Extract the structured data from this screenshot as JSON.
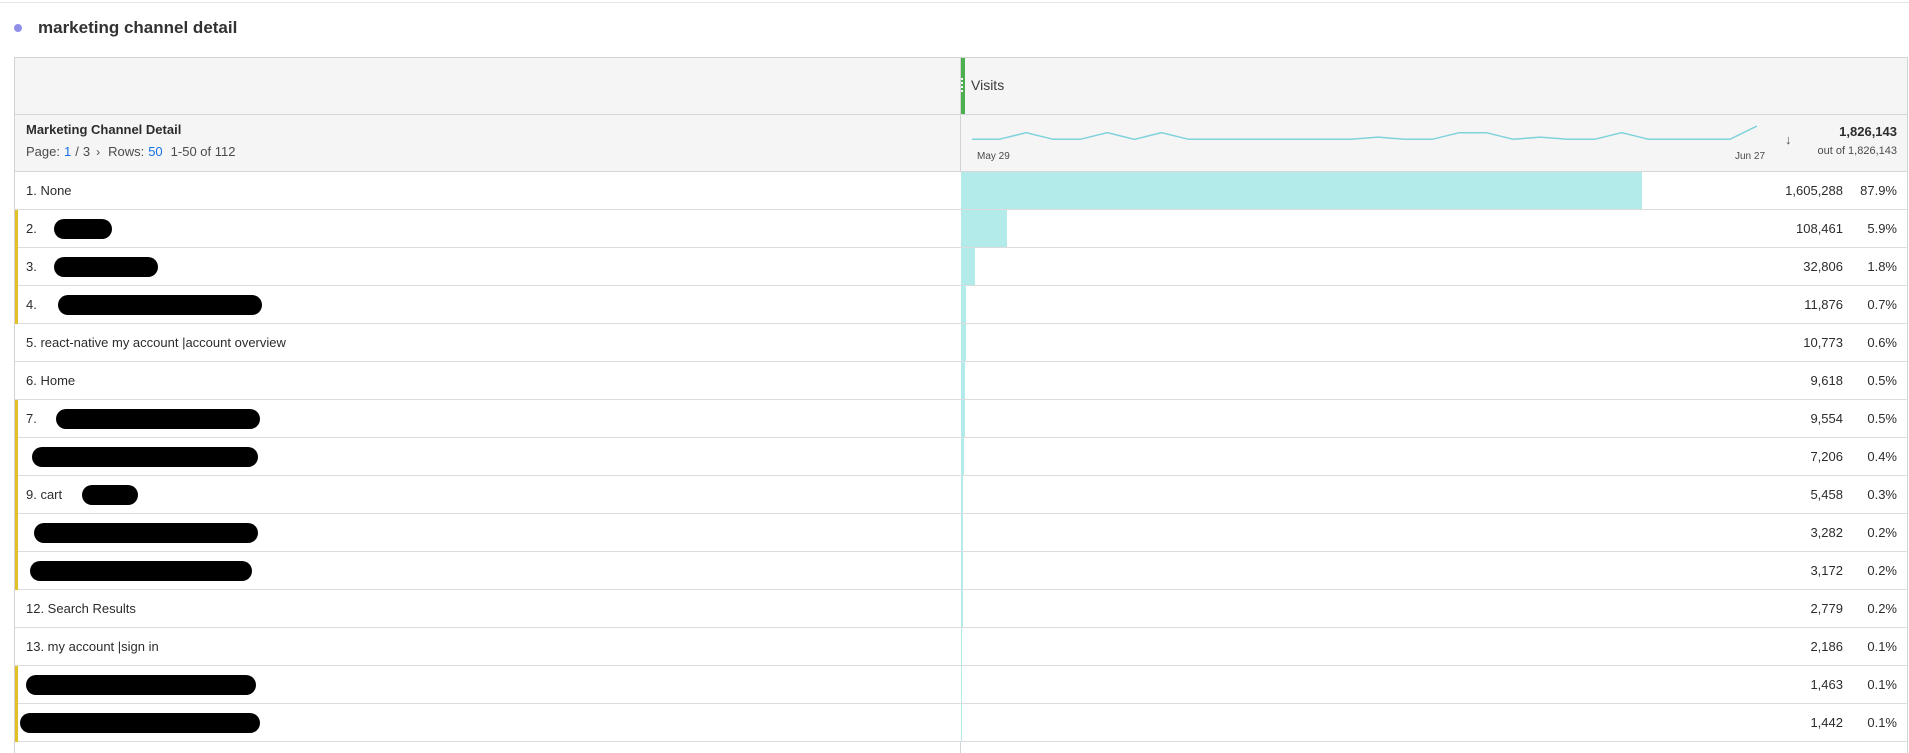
{
  "panel": {
    "title": "marketing channel detail",
    "dot_color": "#8f8fe8"
  },
  "table": {
    "metric_label": "Visits",
    "dimension_title": "Marketing Channel Detail",
    "pager": {
      "page_label": "Page:",
      "current_page": "1",
      "page_sep": "/",
      "total_pages": "3",
      "chevron": "›",
      "rows_label": "Rows:",
      "rows_value": "50",
      "range": "1-50 of 112"
    },
    "sparkline": {
      "start_label": "May 29",
      "end_label": "Jun 27",
      "color": "#7fd2dc",
      "points": [
        3,
        3,
        6,
        3,
        3,
        6,
        3,
        6,
        3,
        3,
        3,
        3,
        3,
        3,
        3,
        4,
        3,
        3,
        6,
        6,
        3,
        4,
        3,
        3,
        6,
        3,
        3,
        3,
        3,
        9
      ]
    },
    "sort_icon": "arrow-down-icon",
    "total": "1,826,143",
    "total_sub": "out of 1,826,143",
    "bar_color": "#b3ebeb",
    "accent_color": "#e3c028",
    "metric_color": "#4caf50",
    "rows": [
      {
        "label": "1.  None",
        "value": "1,605,288",
        "pct": "87.9%",
        "share": 0.879
      },
      {
        "label": "2.",
        "value": "108,461",
        "pct": "5.9%",
        "share": 0.059,
        "redacted": true
      },
      {
        "label": "3.",
        "value": "32,806",
        "pct": "1.8%",
        "share": 0.018,
        "redacted": true
      },
      {
        "label": "4.",
        "value": "11,876",
        "pct": "0.7%",
        "share": 0.007,
        "redacted": true
      },
      {
        "label": "5.  react-native my account |account overview",
        "value": "10,773",
        "pct": "0.6%",
        "share": 0.006
      },
      {
        "label": "6.  Home",
        "value": "9,618",
        "pct": "0.5%",
        "share": 0.005
      },
      {
        "label": "7.",
        "value": "9,554",
        "pct": "0.5%",
        "share": 0.005,
        "redacted": true
      },
      {
        "label": "",
        "value": "7,206",
        "pct": "0.4%",
        "share": 0.004,
        "redacted": true
      },
      {
        "label": "9.  cart",
        "value": "5,458",
        "pct": "0.3%",
        "share": 0.003,
        "redacted": true
      },
      {
        "label": "",
        "value": "3,282",
        "pct": "0.2%",
        "share": 0.002,
        "redacted": true
      },
      {
        "label": "",
        "value": "3,172",
        "pct": "0.2%",
        "share": 0.002,
        "redacted": true
      },
      {
        "label": "12.  Search Results",
        "value": "2,779",
        "pct": "0.2%",
        "share": 0.002
      },
      {
        "label": "13.  my account |sign in",
        "value": "2,186",
        "pct": "0.1%",
        "share": 0.001
      },
      {
        "label": "",
        "value": "1,463",
        "pct": "0.1%",
        "share": 0.001,
        "redacted": true
      },
      {
        "label": "",
        "value": "1,442",
        "pct": "0.1%",
        "share": 0.001,
        "redacted": true
      }
    ]
  }
}
